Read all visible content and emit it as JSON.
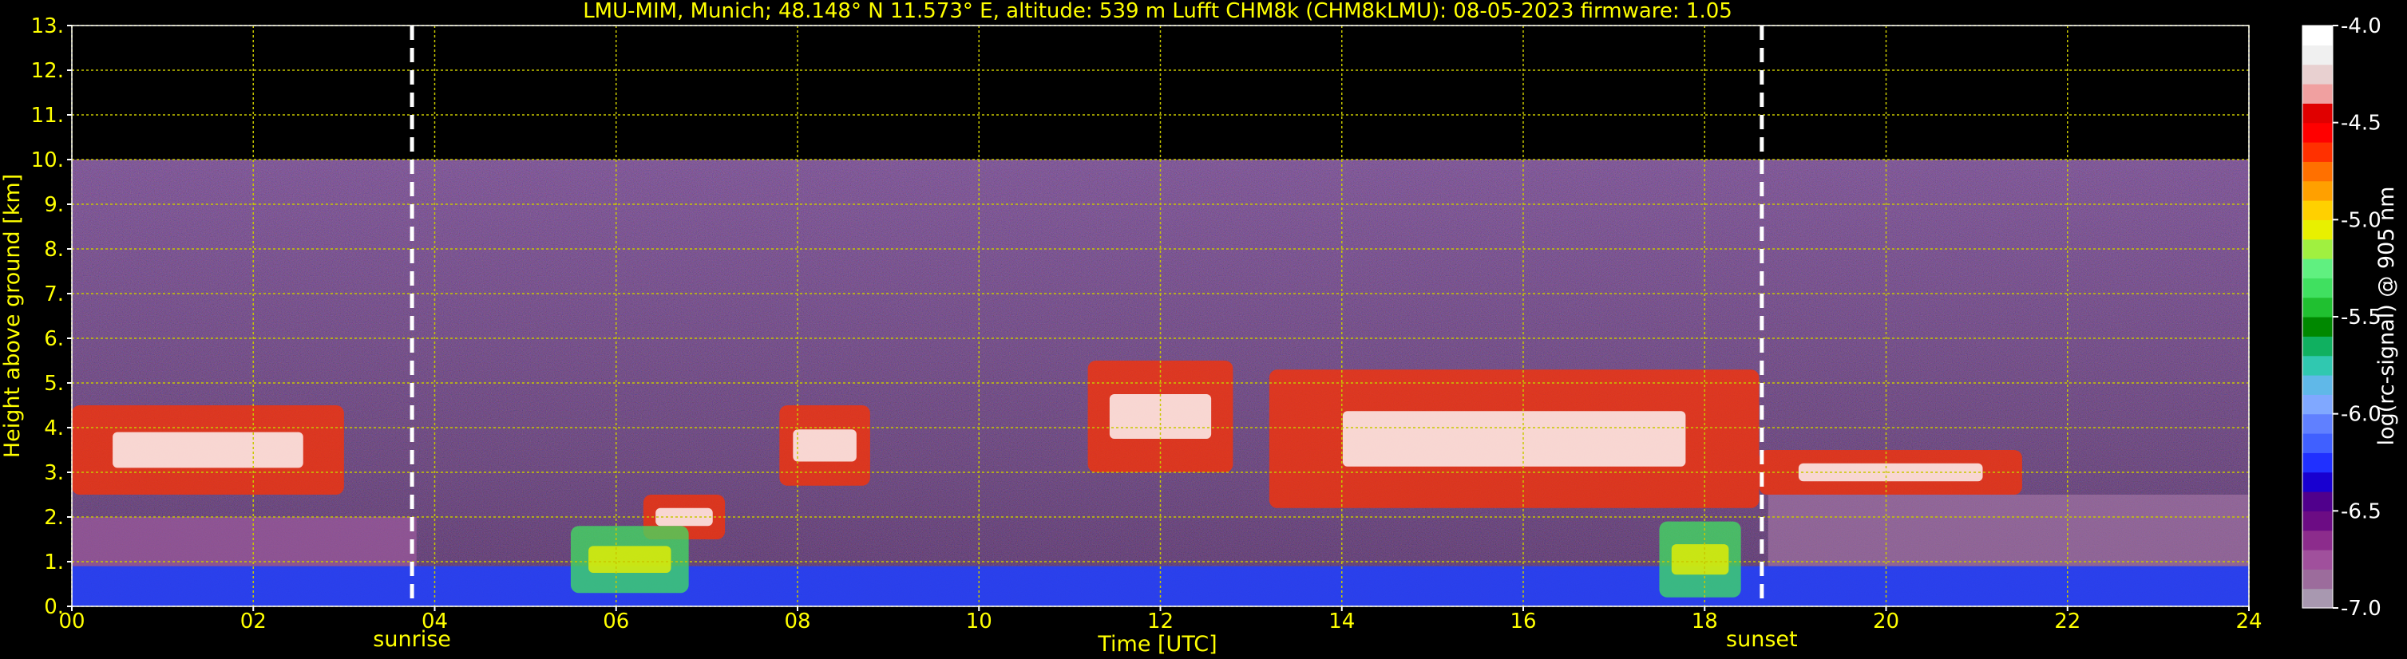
{
  "chart_data": {
    "type": "heatmap",
    "title": "LMU-MIM, Munich; 48.148° N 11.573° E, altitude: 539 m    Lufft CHM8k (CHM8kLMU): 08-05-2023    firmware: 1.05",
    "xlabel": "Time [UTC]",
    "ylabel": "Height above ground [km]",
    "xlim": [
      0,
      24
    ],
    "ylim": [
      0,
      13
    ],
    "x_ticks": [
      "00",
      "02",
      "04",
      "06",
      "08",
      "10",
      "12",
      "14",
      "16",
      "18",
      "20",
      "22",
      "24"
    ],
    "y_ticks": [
      "0.",
      "1.",
      "2.",
      "3.",
      "4.",
      "5.",
      "6.",
      "7.",
      "8.",
      "9.",
      "10.",
      "11.",
      "12.",
      "13."
    ],
    "grid": true,
    "signal_top_km": 10,
    "markers": [
      {
        "label": "sunrise",
        "x": 3.75
      },
      {
        "label": "sunset",
        "x": 18.63
      }
    ],
    "colorbar": {
      "label": "log(rc-signal) @ 905 nm",
      "range": [
        -7.0,
        -4.0
      ],
      "ticks": [
        "-4.0",
        "-4.5",
        "-5.0",
        "-5.5",
        "-6.0",
        "-6.5",
        "-7.0"
      ],
      "colors": [
        "#a898b0",
        "#9c6c9c",
        "#a0509c",
        "#8c2c8c",
        "#6c0c84",
        "#50008c",
        "#1800d0",
        "#2030ff",
        "#4060ff",
        "#6080ff",
        "#80a8ff",
        "#60b8e8",
        "#30c8b0",
        "#10b060",
        "#008800",
        "#20c030",
        "#40e060",
        "#60f080",
        "#a0f040",
        "#e8f000",
        "#ffd000",
        "#ffa000",
        "#ff7000",
        "#ff3000",
        "#ff0000",
        "#e00000",
        "#f0a0a0",
        "#e8d0d0",
        "#f0f0f0",
        "#ffffff"
      ]
    },
    "features": [
      {
        "kind": "cloud_layer",
        "t_start": 0.0,
        "t_end": 3.0,
        "h_low_km": 2.5,
        "h_high_km": 4.5
      },
      {
        "kind": "cloud_layer",
        "t_start": 6.3,
        "t_end": 7.2,
        "h_low_km": 1.5,
        "h_high_km": 2.5
      },
      {
        "kind": "cloud_layer",
        "t_start": 7.8,
        "t_end": 8.8,
        "h_low_km": 2.7,
        "h_high_km": 4.5
      },
      {
        "kind": "cloud_layer",
        "t_start": 11.2,
        "t_end": 12.8,
        "h_low_km": 3.0,
        "h_high_km": 5.5
      },
      {
        "kind": "cloud_layer",
        "t_start": 13.2,
        "t_end": 18.6,
        "h_low_km": 2.2,
        "h_high_km": 5.3
      },
      {
        "kind": "cloud_layer",
        "t_start": 18.6,
        "t_end": 21.5,
        "h_low_km": 2.5,
        "h_high_km": 3.5
      },
      {
        "kind": "boundary_layer",
        "t_start": 5.5,
        "t_end": 6.8,
        "h_low_km": 0.3,
        "h_high_km": 1.8
      },
      {
        "kind": "boundary_layer",
        "t_start": 17.5,
        "t_end": 18.4,
        "h_low_km": 0.2,
        "h_high_km": 1.9
      }
    ]
  }
}
